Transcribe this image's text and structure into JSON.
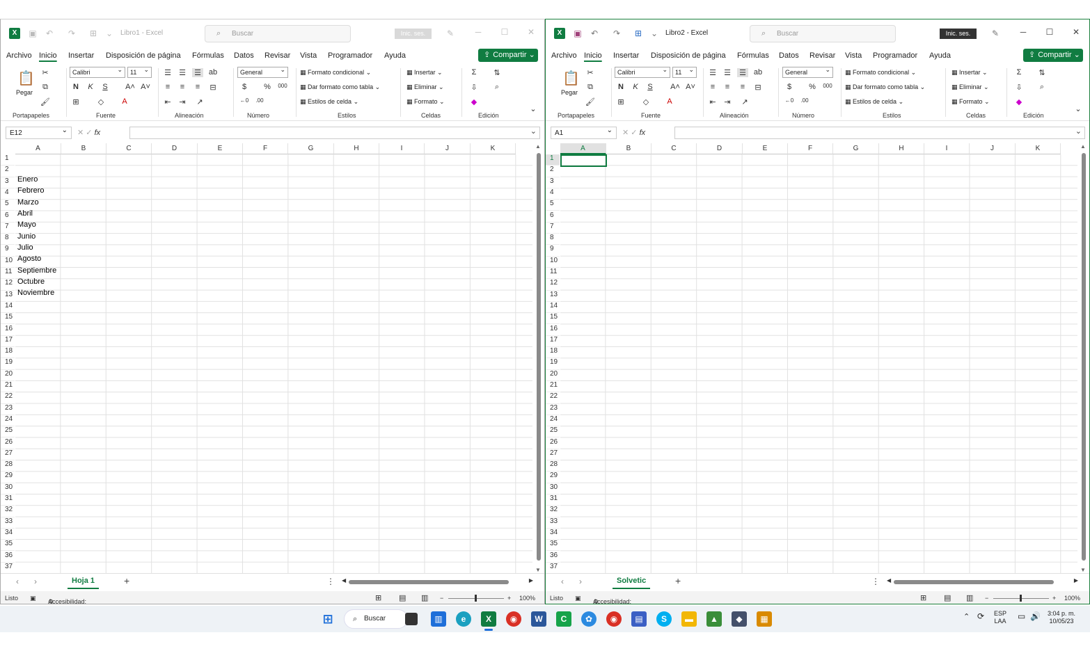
{
  "windows": {
    "left": {
      "title": "Libro1 - Excel",
      "search_placeholder": "Buscar",
      "login": "Inic. ses.",
      "name_box": "E12",
      "sheet_tab": "Hoja 1",
      "cells_col_a": [
        "Enero",
        "Febrero",
        "Marzo",
        "Abril",
        "Mayo",
        "Junio",
        "Julio",
        "Agosto",
        "Septiembre",
        "Octubre",
        "Noviembre"
      ]
    },
    "right": {
      "title": "Libro2 - Excel",
      "search_placeholder": "Buscar",
      "login": "Inic. ses.",
      "name_box": "A1",
      "sheet_tab": "Solvetic"
    }
  },
  "menu": [
    "Archivo",
    "Inicio",
    "Insertar",
    "Disposición de página",
    "Fórmulas",
    "Datos",
    "Revisar",
    "Vista",
    "Programador",
    "Ayuda"
  ],
  "share": "Compartir",
  "ribbon": {
    "paste": "Pegar",
    "font_name": "Calibri",
    "font_size": "11",
    "bold": "N",
    "italic": "K",
    "underline": "S",
    "number_format": "General",
    "cond_format": "Formato condicional",
    "table_format": "Dar formato como tabla",
    "cell_styles": "Estilos de celda",
    "insert": "Insertar",
    "delete": "Eliminar",
    "format": "Formato",
    "groups": [
      "Portapapeles",
      "Fuente",
      "Alineación",
      "Número",
      "Estilos",
      "Celdas",
      "Edición"
    ]
  },
  "columns": [
    "A",
    "B",
    "C",
    "D",
    "E",
    "F",
    "G",
    "H",
    "I",
    "J",
    "K"
  ],
  "status": {
    "ready": "Listo",
    "accessibility": "Accesibilidad: todo correcto",
    "zoom": "100%"
  },
  "taskbar": {
    "search": "Buscar",
    "lang": "ESP",
    "layout": "LAA",
    "time": "3:04 p. m.",
    "date": "10/05/23"
  },
  "colors": {
    "excel_green": "#107c41",
    "accent_dark": "#333333"
  }
}
